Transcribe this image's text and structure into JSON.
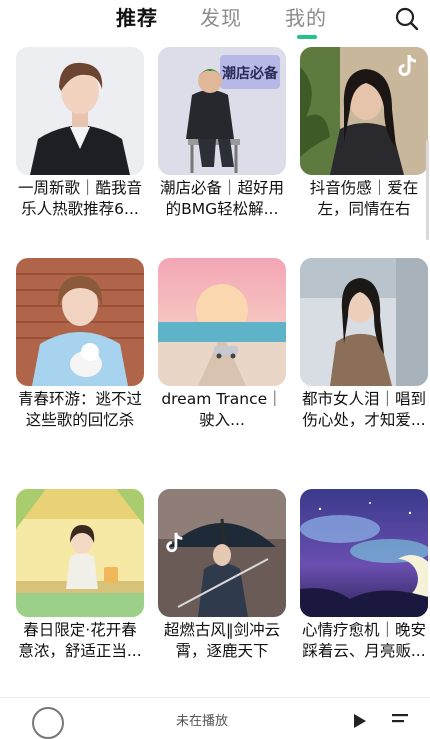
{
  "tabs": [
    {
      "label": "推荐",
      "active": true
    },
    {
      "label": "发现",
      "active": false
    },
    {
      "label": "我的",
      "active": false
    }
  ],
  "accent_color": "#23c28e",
  "search_icon": "search-icon",
  "playlists": [
    {
      "title": "一周新歌｜酷我音乐人热歌推荐6...",
      "cover": "portrait-man-in-black-suit"
    },
    {
      "title": "潮店必备｜超好用的BMG轻松解...",
      "cover": "illustrated-man-sitting-on-chair",
      "cover_text": "潮店必备"
    },
    {
      "title": "抖音伤感｜爱在左，同情在右",
      "cover": "woman-with-plants",
      "badge_icon": "tiktok-icon"
    },
    {
      "title": "青春环游：逃不过这些歌的回忆杀",
      "cover": "girl-holding-white-cat"
    },
    {
      "title": "dream Trance｜驶入...",
      "cover": "pink-sky-moon-car-road"
    },
    {
      "title": "都市女人泪｜唱到伤心处，才知爱...",
      "cover": "woman-by-window"
    },
    {
      "title": "春日限定·花开春意浓，舒适正当...",
      "cover": "illustrated-girl-yellow-room"
    },
    {
      "title": "超燃古风‖剑冲云霄，逐鹿天下",
      "cover": "swordsman-with-umbrella",
      "badge_icon": "tiktok-icon"
    },
    {
      "title": "心情疗愈机｜晚安踩着云、月亮贩...",
      "cover": "night-sky-crescent-moon"
    }
  ],
  "player": {
    "title": "未在播放"
  }
}
